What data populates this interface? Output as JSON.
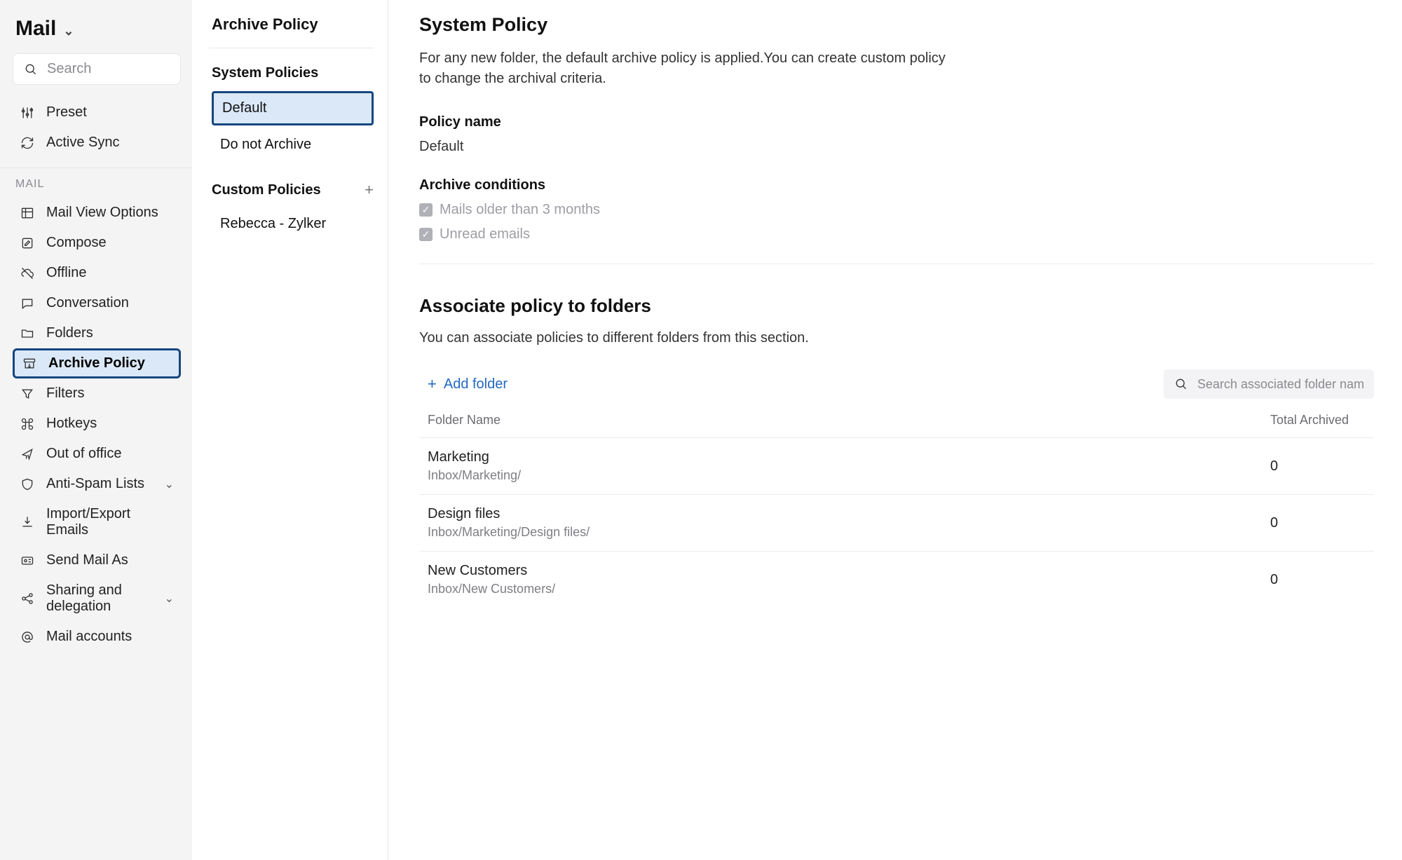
{
  "sidebar": {
    "title": "Mail",
    "search_placeholder": "Search",
    "top_items": [
      {
        "id": "preset",
        "label": "Preset",
        "icon": "sliders"
      },
      {
        "id": "active-sync",
        "label": "Active Sync",
        "icon": "refresh"
      }
    ],
    "section_label": "MAIL",
    "items": [
      {
        "id": "mail-view-options",
        "label": "Mail View Options",
        "icon": "layout"
      },
      {
        "id": "compose",
        "label": "Compose",
        "icon": "edit"
      },
      {
        "id": "offline",
        "label": "Offline",
        "icon": "cloud-off"
      },
      {
        "id": "conversation",
        "label": "Conversation",
        "icon": "chat"
      },
      {
        "id": "folders",
        "label": "Folders",
        "icon": "folder"
      },
      {
        "id": "archive-policy",
        "label": "Archive Policy",
        "icon": "archive",
        "active": true
      },
      {
        "id": "filters",
        "label": "Filters",
        "icon": "filter"
      },
      {
        "id": "hotkeys",
        "label": "Hotkeys",
        "icon": "command"
      },
      {
        "id": "out-of-office",
        "label": "Out of office",
        "icon": "plane"
      },
      {
        "id": "anti-spam",
        "label": "Anti-Spam Lists",
        "icon": "shield",
        "submenu": true
      },
      {
        "id": "import-export",
        "label": "Import/Export Emails",
        "icon": "download"
      },
      {
        "id": "send-mail-as",
        "label": "Send Mail As",
        "icon": "identity"
      },
      {
        "id": "sharing",
        "label": "Sharing and delegation",
        "icon": "share",
        "submenu": true
      },
      {
        "id": "mail-accounts",
        "label": "Mail accounts",
        "icon": "at"
      }
    ]
  },
  "midcol": {
    "title": "Archive Policy",
    "system_heading": "System Policies",
    "system_items": [
      {
        "id": "default",
        "label": "Default",
        "active": true
      },
      {
        "id": "do-not-archive",
        "label": "Do not Archive"
      }
    ],
    "custom_heading": "Custom Policies",
    "custom_items": [
      {
        "id": "rebecca",
        "label": "Rebecca - Zylker"
      }
    ]
  },
  "main": {
    "system_policy": {
      "title": "System Policy",
      "description": "For any new folder, the default archive policy is applied.You can create custom policy to change the archival criteria.",
      "policy_name_label": "Policy name",
      "policy_name_value": "Default",
      "conditions_label": "Archive conditions",
      "conditions": [
        "Mails older than 3 months",
        "Unread emails"
      ]
    },
    "associate": {
      "title": "Associate policy to folders",
      "description": "You can associate policies to different folders from this section.",
      "add_label": "Add folder",
      "search_placeholder": "Search associated folder names",
      "columns": {
        "name": "Folder Name",
        "count": "Total Archived"
      },
      "rows": [
        {
          "name": "Marketing",
          "path": "Inbox/Marketing/",
          "count": "0"
        },
        {
          "name": "Design files",
          "path": "Inbox/Marketing/Design files/",
          "count": "0"
        },
        {
          "name": "New Customers",
          "path": "Inbox/New Customers/",
          "count": "0"
        }
      ]
    }
  }
}
